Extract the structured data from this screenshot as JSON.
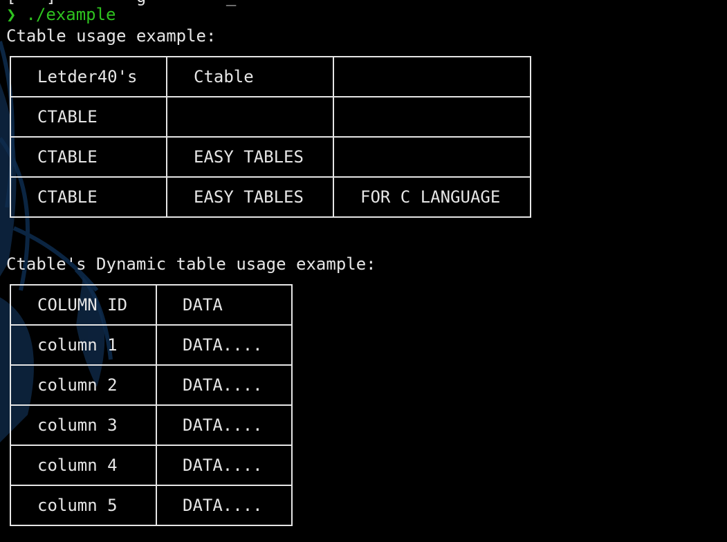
{
  "terminal": {
    "prev_line": "[   ]        g        _",
    "prompt_symbol": "❯",
    "command": "./example",
    "prompt_color": "#2ec21f",
    "text_color": "#e6e6e6",
    "background": "#000000"
  },
  "section1": {
    "label": "Ctable usage example:",
    "rows": [
      [
        "Letder40's",
        "Ctable",
        ""
      ],
      [
        "CTABLE",
        "",
        ""
      ],
      [
        "CTABLE",
        "EASY TABLES",
        ""
      ],
      [
        "CTABLE",
        "EASY TABLES",
        "FOR C LANGUAGE"
      ]
    ]
  },
  "section2": {
    "label": "Ctable's Dynamic table usage example:",
    "rows": [
      [
        "COLUMN ID",
        "DATA"
      ],
      [
        "column 1",
        "DATA...."
      ],
      [
        "column 2",
        "DATA...."
      ],
      [
        "column 3",
        "DATA...."
      ],
      [
        "column 4",
        "DATA...."
      ],
      [
        "column 5",
        "DATA...."
      ]
    ]
  }
}
